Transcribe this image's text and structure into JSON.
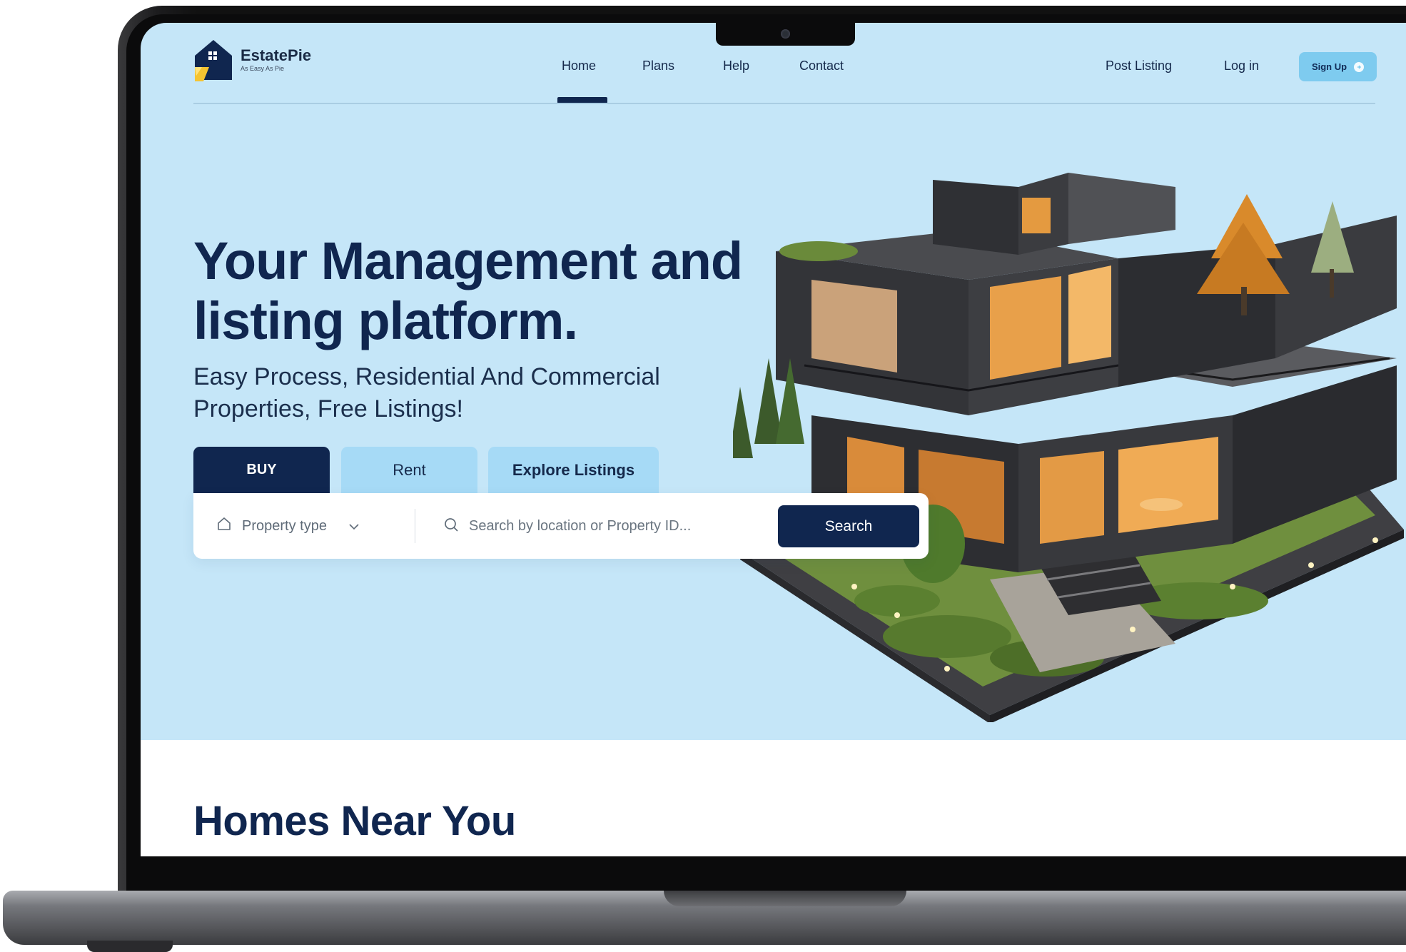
{
  "brand": {
    "name": "EstatePie",
    "tagline": "As Easy As Pie"
  },
  "nav": {
    "items": [
      "Home",
      "Plans",
      "Help",
      "Contact"
    ],
    "active": "Home"
  },
  "header_actions": {
    "post_listing": "Post Listing",
    "login": "Log in",
    "signup": "Sign Up"
  },
  "hero": {
    "title": "Your Management and listing platform.",
    "subtitle": "Easy Process, Residential And Commercial Properties, Free Listings!"
  },
  "tabs": [
    "BUY",
    "Rent",
    "Explore Listings"
  ],
  "search": {
    "property_type": "Property type",
    "placeholder": "Search by location or Property ID...",
    "button": "Search"
  },
  "section": {
    "homes_title": "Homes Near You"
  },
  "colors": {
    "primary_navy": "#10264f",
    "hero_bg": "#c5e6f8",
    "tab_light": "#a6daf6",
    "signup_bg": "#7ecbef"
  },
  "icons": {
    "property_type": "home-outline-icon",
    "dropdown": "chevron-down-icon",
    "search": "search-icon",
    "signup": "arrow-circle-icon"
  }
}
